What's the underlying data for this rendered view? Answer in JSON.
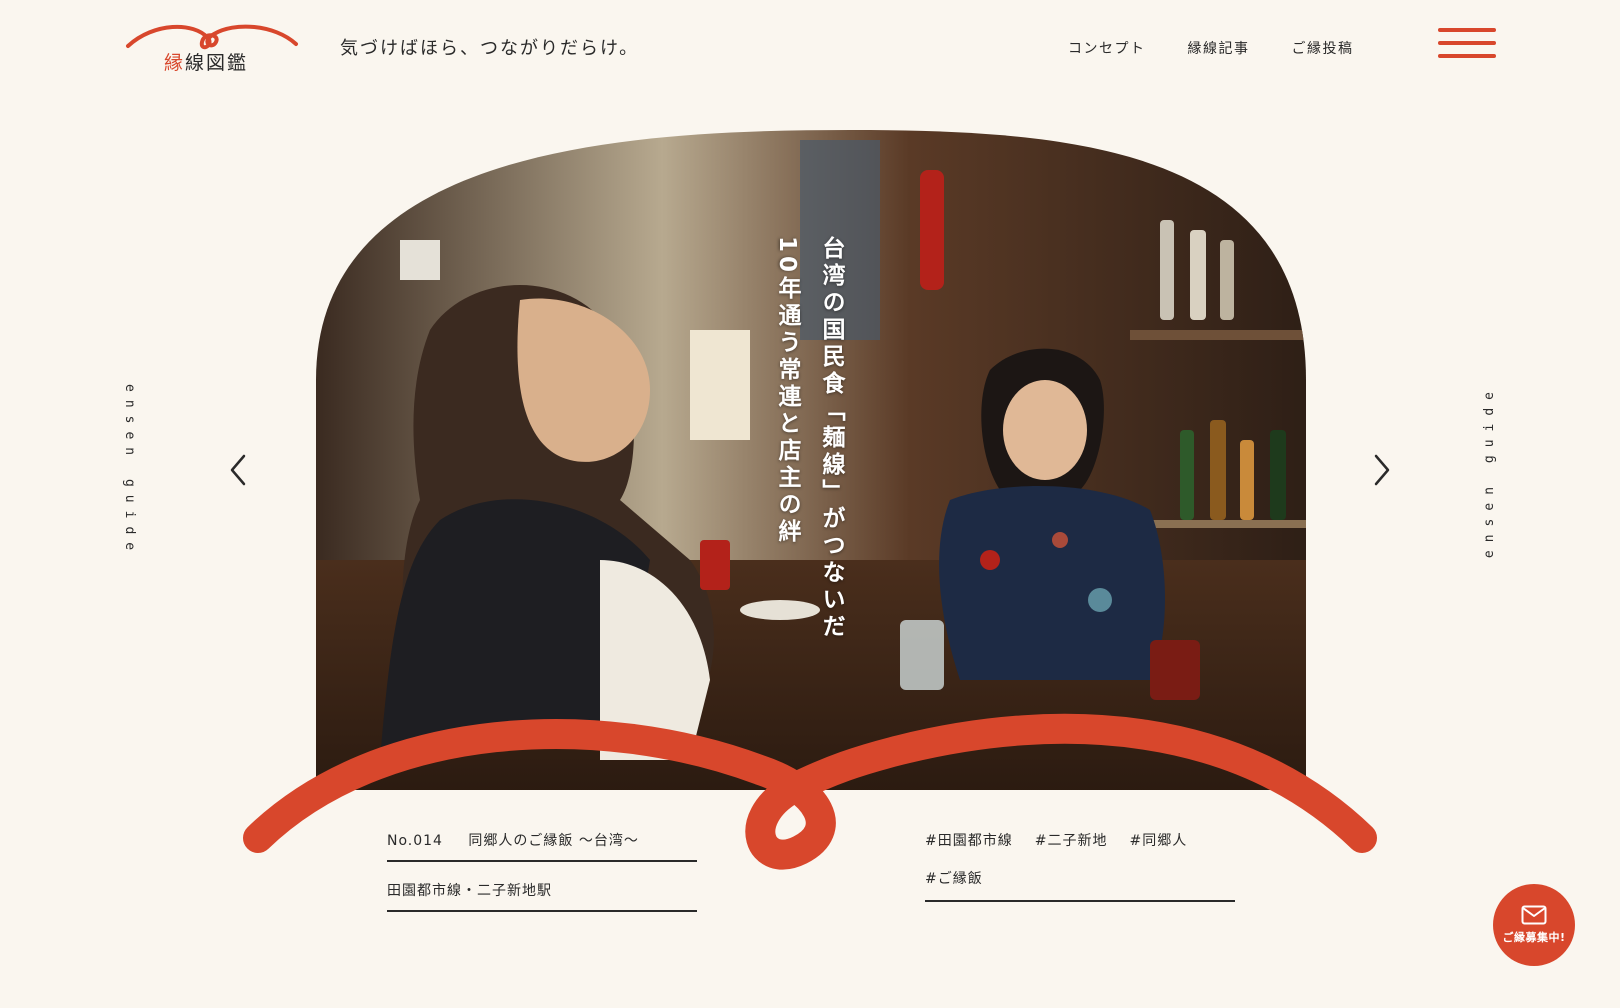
{
  "header": {
    "logo": {
      "accent_char": "縁",
      "rest": "線図鑑"
    },
    "tagline": "気づけばほら、つながりだらけ。",
    "nav": [
      {
        "label": "コンセプト"
      },
      {
        "label": "縁線記事"
      },
      {
        "label": "ご縁投稿"
      }
    ]
  },
  "side_labels": {
    "left": "ensen guide",
    "right": "ensen guide"
  },
  "hero": {
    "title_line_1": "台湾の国民食「麺線」がつないだ",
    "title_line_2": "10年通う常連と店主の絆"
  },
  "article": {
    "number": "No.014",
    "series": "同郷人のご縁飯 〜台湾〜",
    "station": "田園都市線・二子新地駅",
    "tags": [
      "#田園都市線",
      "#二子新地",
      "#同郷人",
      "#ご縁飯"
    ]
  },
  "contact": {
    "label": "ご縁募集中!"
  },
  "colors": {
    "accent": "#d8472c",
    "background": "#faf6ef",
    "text": "#2a2a2a"
  },
  "icons": {
    "menu": "hamburger-icon",
    "prev": "chevron-left-icon",
    "next": "chevron-right-icon",
    "contact": "mail-icon"
  }
}
